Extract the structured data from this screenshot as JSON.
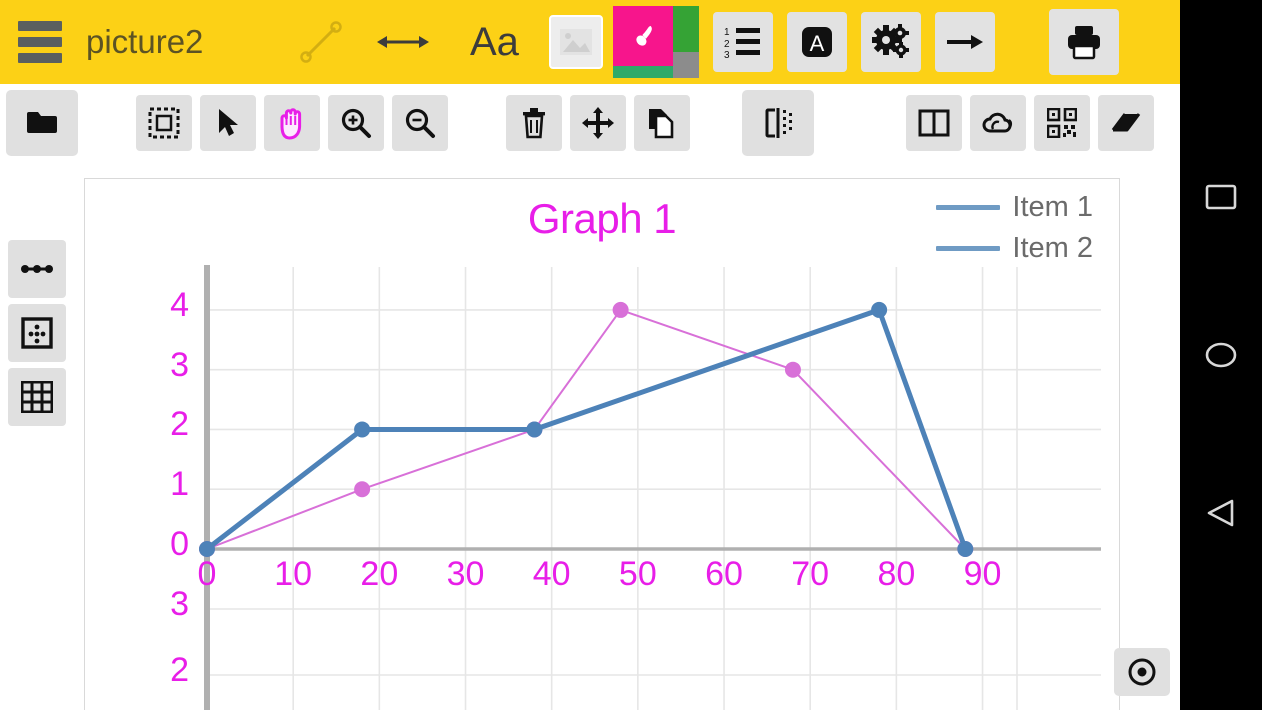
{
  "window": {
    "document_title": "picture2"
  },
  "top_toolbar": {
    "menu_icon": "hamburger-menu-icon",
    "items": [
      {
        "name": "line-tool",
        "icon": "line-segment-icon"
      },
      {
        "name": "arrow-tool",
        "icon": "double-arrow-icon"
      },
      {
        "name": "text-tool",
        "icon": "text-aa-icon",
        "label": "Aa"
      },
      {
        "name": "image-tool",
        "icon": "picture-icon"
      },
      {
        "name": "color-swatch",
        "icon": "paintbrush-icon"
      },
      {
        "name": "numbered-list",
        "icon": "numbered-list-icon",
        "label": "123"
      },
      {
        "name": "font-tool",
        "icon": "letter-a-box-icon",
        "label": "A"
      },
      {
        "name": "settings-tool",
        "icon": "gears-icon"
      },
      {
        "name": "arrow-right",
        "icon": "arrow-right-icon"
      },
      {
        "name": "print",
        "icon": "printer-icon"
      }
    ],
    "colors": {
      "bar_background": "#fcd116",
      "title_text": "#5c5324",
      "swatch_main": "#f7158c",
      "swatch_green": "#35a335",
      "swatch_gray": "#8c8c8c",
      "swatch_bottom": "#2faa68"
    }
  },
  "sub_toolbar": {
    "items": [
      {
        "name": "open-folder",
        "icon": "folder-icon"
      },
      {
        "name": "select-region",
        "icon": "marquee-select-icon"
      },
      {
        "name": "pointer-select",
        "icon": "cursor-arrow-icon"
      },
      {
        "name": "pan-hand",
        "icon": "hand-icon",
        "active": true
      },
      {
        "name": "zoom-in",
        "icon": "magnifier-plus-icon"
      },
      {
        "name": "zoom-out",
        "icon": "magnifier-minus-icon"
      },
      {
        "name": "delete",
        "icon": "trash-icon"
      },
      {
        "name": "move",
        "icon": "move-arrows-icon"
      },
      {
        "name": "copy",
        "icon": "copy-pages-icon"
      },
      {
        "name": "mirror-flip",
        "icon": "flip-horizontal-icon"
      },
      {
        "name": "split-view",
        "icon": "two-columns-icon"
      },
      {
        "name": "cloud-sync",
        "icon": "cloud-icon"
      },
      {
        "name": "qr-code",
        "icon": "qr-code-icon"
      },
      {
        "name": "eraser",
        "icon": "eraser-icon"
      },
      {
        "name": "undo",
        "icon": "undo-arrow-icon"
      }
    ],
    "active_color": "#e81ee8"
  },
  "left_rail": {
    "items": [
      {
        "name": "points-line",
        "icon": "dots-connected-icon"
      },
      {
        "name": "scatter-grid",
        "icon": "framed-dots-icon"
      },
      {
        "name": "table-grid",
        "icon": "grid-table-icon"
      }
    ]
  },
  "floating_button": {
    "name": "record-target-button",
    "icon": "target-circle-icon"
  },
  "android_nav": {
    "recents": {
      "name": "recents-button",
      "icon": "square-icon"
    },
    "home": {
      "name": "home-button",
      "icon": "circle-icon"
    },
    "back": {
      "name": "back-button",
      "icon": "triangle-left-icon"
    }
  },
  "chart_data": {
    "type": "line",
    "title": "Graph 1",
    "xlabel": "",
    "ylabel": "",
    "grid": true,
    "legend_position": "top-right",
    "xlim": [
      0,
      94
    ],
    "ylim": [
      0,
      4.35
    ],
    "xticks": [
      0,
      10,
      20,
      30,
      40,
      50,
      60,
      70,
      80,
      90
    ],
    "yticks": [
      0,
      1,
      2,
      3,
      4
    ],
    "extra_lower_yticks": [
      3,
      2
    ],
    "title_color": "#e81ee8",
    "tick_color": "#e81ee8",
    "grid_color": "#e6e6e6",
    "axis_color": "#b0b0b0",
    "series": [
      {
        "name": "Item 1",
        "color": "#4d82b8",
        "marker": "circle",
        "linewidth": 5,
        "x": [
          0,
          18,
          38,
          78,
          88
        ],
        "y": [
          0,
          2,
          2,
          4,
          0
        ]
      },
      {
        "name": "Item 2",
        "color": "#d870d8",
        "marker": "circle",
        "linewidth": 2,
        "x": [
          0,
          18,
          38,
          48,
          68,
          88
        ],
        "y": [
          0,
          1,
          2,
          4,
          3,
          0
        ]
      }
    ],
    "legend_entries": [
      {
        "label": "Item 1",
        "color": "#6f9bc4"
      },
      {
        "label": "Item 2",
        "color": "#6f9bc4"
      }
    ]
  }
}
